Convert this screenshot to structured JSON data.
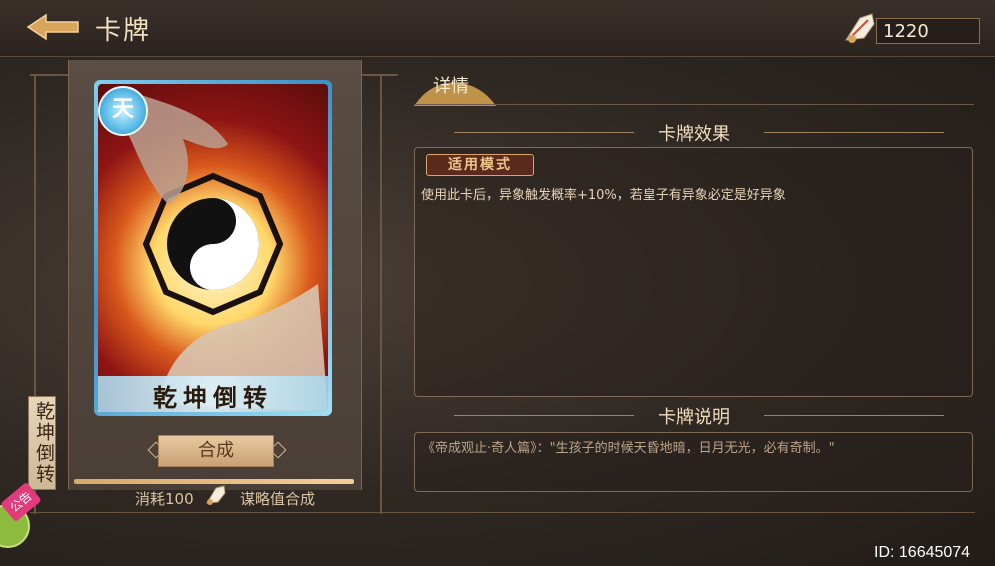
{
  "header": {
    "title": "卡牌",
    "back_icon": "back-arrow-icon",
    "currency_icon": "feather-fan-icon",
    "currency_value": "1220"
  },
  "card": {
    "badge": "天",
    "name": "乾坤倒转",
    "frame_color": "#4fa9d8",
    "art_colors": [
      "#fff7d8",
      "#ffd86a",
      "#d9591c",
      "#8e1414"
    ]
  },
  "side_tab": {
    "label": "乾坤倒转"
  },
  "notice": {
    "label": "公告",
    "chat_icon": "chat-bubble-icon"
  },
  "compose": {
    "button_label": "合成",
    "progress": 1.0,
    "cost_label": "消耗100",
    "cost_icon": "feather-fan-icon",
    "cost_suffix": "谋略值合成"
  },
  "details": {
    "tab_label": "详情",
    "effect_section_title": "卡牌效果",
    "mode_tag": "适用模式",
    "effect_text": "使用此卡后，异象触发概率+10%，若皇子有异象必定是好异象",
    "desc_section_title": "卡牌说明",
    "desc_text": "《帝成观止·奇人篇》：\"生孩子的时候天昏地暗，日月无光，必有奇制。\""
  },
  "footer": {
    "id_text": "ID: 16645074"
  }
}
